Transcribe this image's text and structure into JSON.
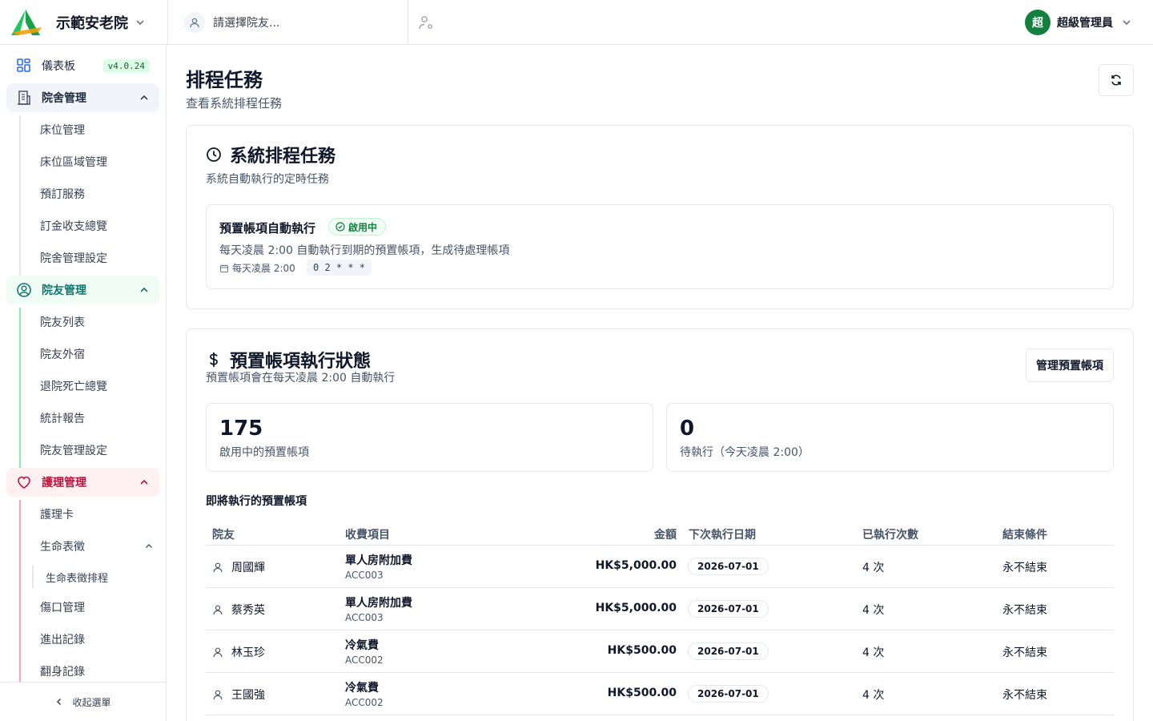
{
  "header": {
    "brand_name": "示範安老院",
    "resident_placeholder": "請選擇院友...",
    "user_initial": "超",
    "user_name": "超級管理員"
  },
  "sidebar": {
    "dashboard": {
      "label": "儀表板",
      "version": "v4.0.24"
    },
    "facility": {
      "label": "院舍管理",
      "items": [
        "床位管理",
        "床位區域管理",
        "預訂服務",
        "訂金收支總覽",
        "院舍管理設定"
      ]
    },
    "residents": {
      "label": "院友管理",
      "items": [
        "院友列表",
        "院友外宿",
        "退院死亡總覽",
        "統計報告",
        "院友管理設定"
      ]
    },
    "care": {
      "label": "護理管理",
      "items": [
        "護理卡",
        "生命表徵",
        "傷口管理",
        "進出記錄",
        "翻身記錄"
      ],
      "vitals_sub": "生命表徵排程"
    },
    "collapse_label": "收起選單"
  },
  "colors": {
    "accent": "#15803d",
    "residents": "#0f766e",
    "care": "#be123c"
  },
  "page": {
    "title": "排程任務",
    "subtitle": "查看系統排程任務"
  },
  "system_tasks": {
    "title": "系統排程任務",
    "description": "系統自動執行的定時任務",
    "task": {
      "name": "預置帳項自動執行",
      "status": "啟用中",
      "description": "每天凌晨 2:00 自動執行到期的預置帳項，生成待處理帳項",
      "schedule": "每天凌晨 2:00",
      "cron": "0 2 * * *"
    }
  },
  "preset_status": {
    "title": "預置帳項執行狀態",
    "description": "預置帳項會在每天凌晨 2:00 自動執行",
    "manage_label": "管理預置帳項",
    "stats": [
      {
        "value": "175",
        "label": "啟用中的預置帳項"
      },
      {
        "value": "0",
        "label": "待執行（今天凌晨 2:00）"
      }
    ],
    "table_title": "即將執行的預置帳項",
    "columns": [
      "院友",
      "收費項目",
      "金額",
      "下次執行日期",
      "已執行次數",
      "結束條件"
    ],
    "rows": [
      {
        "resident": "周國輝",
        "item": "單人房附加費",
        "code": "ACC003",
        "amount": "HK$5,000.00",
        "next_date": "2026-07-01",
        "runs": "4 次",
        "end": "永不結束"
      },
      {
        "resident": "蔡秀英",
        "item": "單人房附加費",
        "code": "ACC003",
        "amount": "HK$5,000.00",
        "next_date": "2026-07-01",
        "runs": "4 次",
        "end": "永不結束"
      },
      {
        "resident": "林玉珍",
        "item": "冷氣費",
        "code": "ACC002",
        "amount": "HK$500.00",
        "next_date": "2026-07-01",
        "runs": "4 次",
        "end": "永不結束"
      },
      {
        "resident": "王國強",
        "item": "冷氣費",
        "code": "ACC002",
        "amount": "HK$500.00",
        "next_date": "2026-07-01",
        "runs": "4 次",
        "end": "永不結束"
      }
    ]
  }
}
